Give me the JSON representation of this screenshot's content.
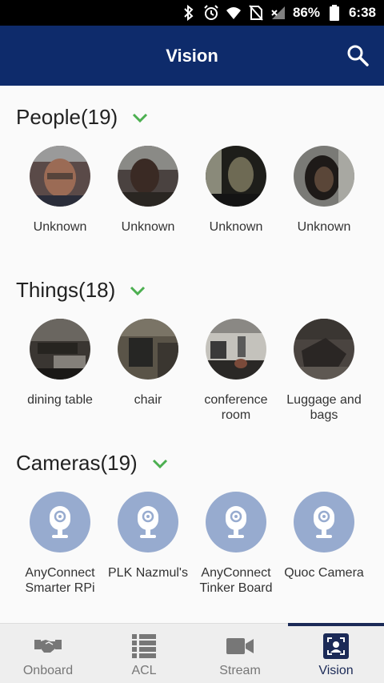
{
  "status_bar": {
    "battery": "86%",
    "time": "6:38"
  },
  "app_bar": {
    "title": "Vision"
  },
  "sections": {
    "people": {
      "title": "People(19)",
      "items": [
        {
          "label": "Unknown"
        },
        {
          "label": "Unknown"
        },
        {
          "label": "Unknown"
        },
        {
          "label": "Unknown"
        }
      ]
    },
    "things": {
      "title": "Things(18)",
      "items": [
        {
          "label": "dining table"
        },
        {
          "label": "chair"
        },
        {
          "label": "conference room"
        },
        {
          "label": "Luggage and bags"
        }
      ]
    },
    "cameras": {
      "title": "Cameras(19)",
      "items": [
        {
          "label": "AnyConnect Smarter RPi"
        },
        {
          "label": "PLK Nazmul's"
        },
        {
          "label": "AnyConnect Tinker Board"
        },
        {
          "label": "Quoc Camera"
        }
      ]
    }
  },
  "bottom_nav": {
    "items": [
      {
        "label": "Onboard",
        "icon": "handshake-icon"
      },
      {
        "label": "ACL",
        "icon": "list-icon"
      },
      {
        "label": "Stream",
        "icon": "video-camera-icon"
      },
      {
        "label": "Vision",
        "icon": "face-scan-icon"
      }
    ],
    "active": "Vision"
  },
  "colors": {
    "app_bar": "#0e2b6b",
    "accent_chevron": "#4caf50",
    "camera_circle": "#97abcf",
    "nav_active": "#1b2a57"
  }
}
